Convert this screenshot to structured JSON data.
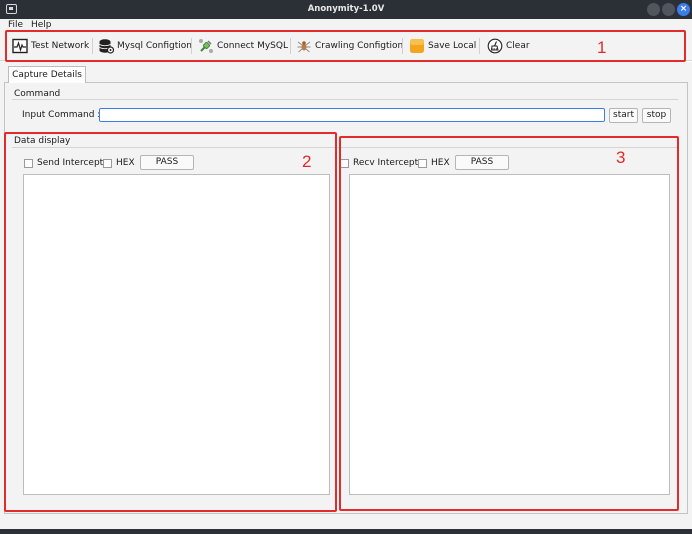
{
  "window": {
    "title": "Anonymity-1.0V"
  },
  "menu": {
    "file": "File",
    "help": "Help"
  },
  "toolbar": {
    "test_network": "Test Network",
    "mysql_config": "Mysql Configtion",
    "connect_mysql": "Connect MySQL",
    "crawling_config": "Crawling Configtion",
    "save_local": "Save Local",
    "clear": "Clear"
  },
  "tabs": {
    "capture_details": "Capture Details"
  },
  "command": {
    "group": "Command",
    "input_label": "Input Command :",
    "input_value": "",
    "start": "start",
    "stop": "stop"
  },
  "data_display": {
    "group": "Data display",
    "send_intercept": "Send Intercept",
    "recv_intercept": "Recv Intercept",
    "hex": "HEX",
    "pass": "PASS"
  },
  "annotations": {
    "a1": "1",
    "a2": "2",
    "a3": "3"
  },
  "colors": {
    "annotation": "#e32b2b",
    "accent": "#3d7dea",
    "titlebar": "#2b2f36"
  }
}
